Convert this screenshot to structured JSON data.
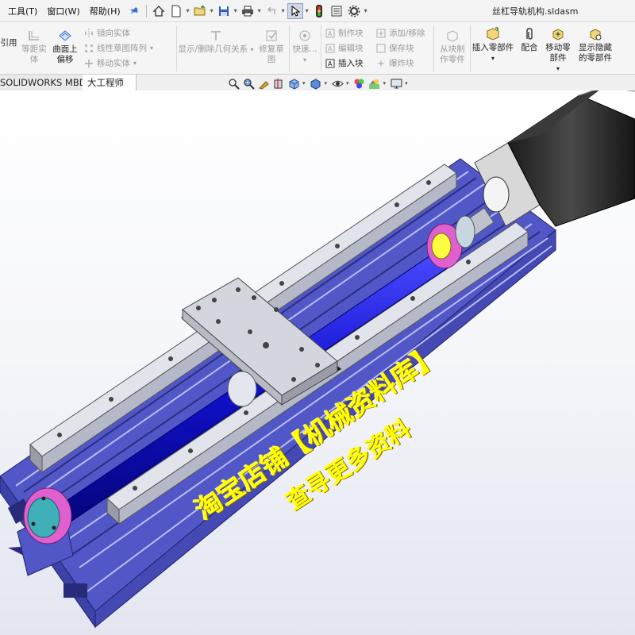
{
  "menu": {
    "items": [
      {
        "label": "工具(T)"
      },
      {
        "label": "窗口(W)"
      },
      {
        "label": "帮助(H)"
      }
    ],
    "pin_icon": "pin-icon"
  },
  "quick_access": {
    "icons": [
      "home-icon",
      "new-document-icon",
      "open-folder-icon",
      "save-icon",
      "print-icon",
      "undo-icon",
      "select-arrow-icon",
      "traffic-light-icon",
      "file-properties-icon",
      "options-gear-icon"
    ]
  },
  "window": {
    "title": "丝杠导轨机构.sldasm"
  },
  "ribbon": {
    "ref_partial": "引用",
    "equal_distance": "等距实体",
    "offset_on_surface": "曲面上偏移",
    "mirror_entities": "镜向实体",
    "linear_pattern": "线性草图阵列",
    "move_entities": "移动实体",
    "show_delete_relations": "显示/删除几何关系",
    "repair_sketch": "修复草图",
    "quick_snaps": "快速...",
    "make_block": "制作块",
    "edit_block": "编辑块",
    "insert_block": "插入块",
    "add_remove": "添加/移除",
    "save_block": "保存块",
    "explode_block": "爆炸块",
    "part_from_block": "从块制作零件",
    "insert_component": "插入零部件",
    "mate": "配合",
    "move_component": "移动零部件",
    "show_hidden": "显示隐藏的零部件"
  },
  "tabs": [
    {
      "label": "SOLIDWORKS MBD"
    },
    {
      "label": "大工程师"
    }
  ],
  "heads_up": {
    "icons": [
      "zoom-to-fit-icon",
      "zoom-area-icon",
      "previous-view-icon",
      "section-view-icon",
      "view-orientation-icon",
      "display-style-icon",
      "hide-show-icon",
      "edit-appearance-icon",
      "apply-scene-icon",
      "view-settings-icon"
    ]
  },
  "watermark": {
    "line1": "淘宝店铺【机械资料库】",
    "line2": "查寻更多资料"
  },
  "colors": {
    "frame_blue": "#5257c8",
    "screw_blue": "#1414d8",
    "rail_gray": "#c9ccd6",
    "motor_black": "#2a2a2a",
    "bearing_magenta": "#e060d0",
    "bearing_cyan": "#40b0b8",
    "watermark_yellow": "#ffff00"
  }
}
